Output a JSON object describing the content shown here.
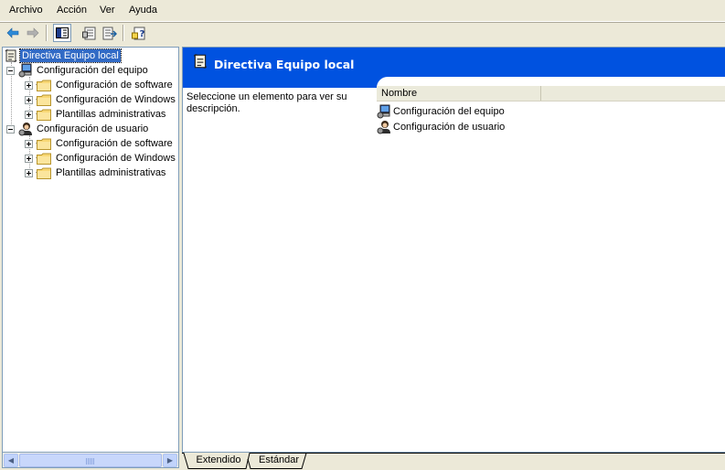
{
  "menu": {
    "items": [
      "Archivo",
      "Acción",
      "Ver",
      "Ayuda"
    ]
  },
  "toolbar": {
    "buttons": [
      "back-icon",
      "forward-icon",
      "show-hide-tree-icon",
      "properties-icon",
      "export-list-icon",
      "help-icon"
    ]
  },
  "tree": {
    "root": "Directiva Equipo local",
    "computer_config": "Configuración del equipo",
    "computer_children": [
      "Configuración de software",
      "Configuración de Windows",
      "Plantillas administrativas"
    ],
    "user_config": "Configuración de usuario",
    "user_children": [
      "Configuración de software",
      "Configuración de Windows",
      "Plantillas administrativas"
    ]
  },
  "banner": {
    "title": "Directiva Equipo local",
    "color": "#0052e0"
  },
  "description": "Seleccione un elemento para ver su descripción.",
  "list": {
    "header": "Nombre",
    "rows": [
      "Configuración del equipo",
      "Configuración de usuario"
    ]
  },
  "tabs": {
    "extended": "Extendido",
    "standard": "Estándar"
  }
}
